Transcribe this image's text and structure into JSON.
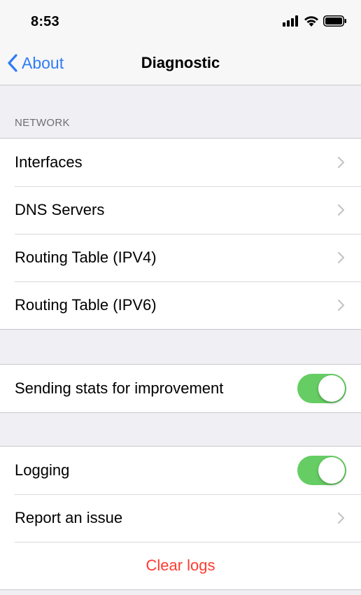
{
  "status_bar": {
    "time": "8:53",
    "icons": [
      "cellular-signal-icon",
      "wifi-icon",
      "battery-icon"
    ]
  },
  "nav": {
    "back_label": "About",
    "title": "Diagnostic"
  },
  "network_section": {
    "header": "NETWORK",
    "items": [
      {
        "label": "Interfaces"
      },
      {
        "label": "DNS Servers"
      },
      {
        "label": "Routing Table (IPV4)"
      },
      {
        "label": "Routing Table (IPV6)"
      }
    ]
  },
  "stats_section": {
    "label": "Sending stats for improvement",
    "enabled": true
  },
  "logging_section": {
    "logging_label": "Logging",
    "logging_enabled": true,
    "report_label": "Report an issue",
    "clear_label": "Clear logs"
  },
  "colors": {
    "accent": "#2f7cf6",
    "toggle_on": "#65cd63",
    "destructive": "#ff3b30",
    "background": "#efeff4"
  }
}
